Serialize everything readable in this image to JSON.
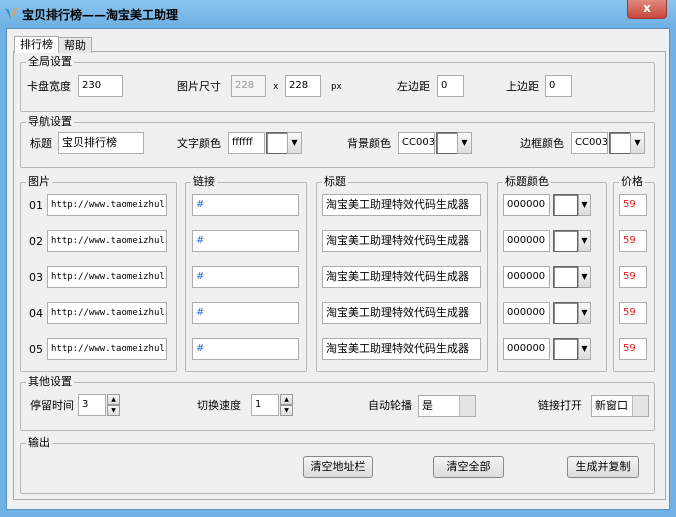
{
  "window": {
    "title": "宝贝排行榜——淘宝美工助理",
    "close": "x"
  },
  "tabs": [
    "排行榜",
    "帮助"
  ],
  "global": {
    "legend": "全局设置",
    "card_width_label": "卡盘宽度",
    "card_width": "230",
    "img_size_label": "图片尺寸",
    "img_w": "228",
    "x": "x",
    "img_h": "228",
    "px": "px",
    "left_margin_label": "左边距",
    "left_margin": "0",
    "top_margin_label": "上边距",
    "top_margin": "0"
  },
  "nav": {
    "legend": "导航设置",
    "title_label": "标题",
    "title": "宝贝排行榜",
    "text_color_label": "文字颜色",
    "text_color": "ffffff",
    "bg_color_label": "背景颜色",
    "bg_color": "CC0033",
    "border_color_label": "边框颜色",
    "border_color": "CC0033"
  },
  "columns": {
    "image": "图片",
    "link": "链接",
    "title": "标题",
    "title_color": "标题颜色",
    "price": "价格"
  },
  "rows": [
    {
      "num": "01",
      "image": "http://www.taomeizhuli",
      "link": "#",
      "title": "淘宝美工助理特效代码生成器",
      "color": "000000",
      "price": "59"
    },
    {
      "num": "02",
      "image": "http://www.taomeizhuli",
      "link": "#",
      "title": "淘宝美工助理特效代码生成器",
      "color": "000000",
      "price": "59"
    },
    {
      "num": "03",
      "image": "http://www.taomeizhuli",
      "link": "#",
      "title": "淘宝美工助理特效代码生成器",
      "color": "000000",
      "price": "59"
    },
    {
      "num": "04",
      "image": "http://www.taomeizhuli",
      "link": "#",
      "title": "淘宝美工助理特效代码生成器",
      "color": "000000",
      "price": "59"
    },
    {
      "num": "05",
      "image": "http://www.taomeizhuli",
      "link": "#",
      "title": "淘宝美工助理特效代码生成器",
      "color": "000000",
      "price": "59"
    }
  ],
  "other": {
    "legend": "其他设置",
    "stay_label": "停留时间",
    "stay": "3",
    "speed_label": "切换速度",
    "speed": "1",
    "autoplay_label": "自动轮播",
    "autoplay": "是",
    "open_label": "链接打开",
    "open": "新窗口"
  },
  "output": {
    "legend": "输出",
    "clear_address": "清空地址栏",
    "clear_all": "清空全部",
    "generate_copy": "生成并复制"
  }
}
